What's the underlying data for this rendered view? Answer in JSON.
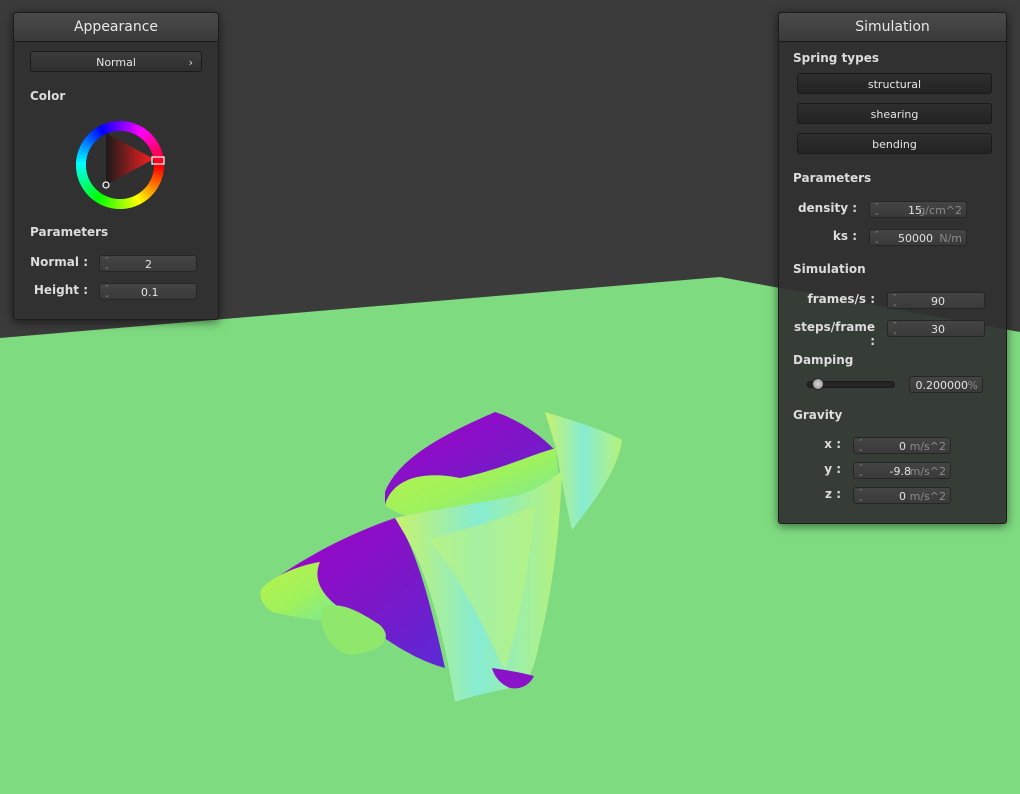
{
  "colors": {
    "sky": "#3b3b3b",
    "ground": "#7fdb80",
    "cloth_green": "#9ff25c",
    "cloth_purple": "#8a12c8",
    "cloth_cyan": "#7fe8d8"
  },
  "appearance": {
    "title": "Appearance",
    "shader_select": "Normal",
    "color_label": "Color",
    "parameters_label": "Parameters",
    "normal_label": "Normal :",
    "normal_value": "2",
    "height_label": "Height :",
    "height_value": "0.1"
  },
  "simulation": {
    "title": "Simulation",
    "spring_types_label": "Spring types",
    "structural_label": "structural",
    "shearing_label": "shearing",
    "bending_label": "bending",
    "parameters_label": "Parameters",
    "density_label": "density :",
    "density_value": "15",
    "density_unit": "g/cm^2",
    "ks_label": "ks :",
    "ks_value": "50000",
    "ks_unit": "N/m",
    "simulation_label": "Simulation",
    "fps_label": "frames/s :",
    "fps_value": "90",
    "steps_label": "steps/frame :",
    "steps_value": "30",
    "damping_label": "Damping",
    "damping_fraction": 0.12,
    "damping_value": "0.200000",
    "damping_unit": "%",
    "gravity_label": "Gravity",
    "gx_label": "x :",
    "gx_value": "0",
    "gx_unit": "m/s^2",
    "gy_label": "y :",
    "gy_value": "-9.8",
    "gy_unit": "m/s^2",
    "gz_label": "z :",
    "gz_value": "0",
    "gz_unit": "m/s^2"
  },
  "icons": {
    "chevron": "›",
    "spinner": "⌃⌄"
  }
}
